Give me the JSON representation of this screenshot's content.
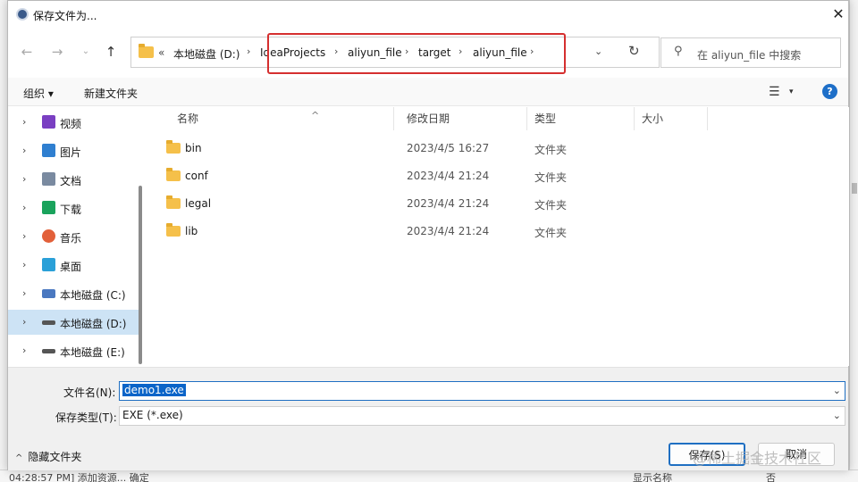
{
  "dialog": {
    "title": "保存文件为...",
    "close_glyph": "✕"
  },
  "nav": {
    "back_glyph": "←",
    "forward_glyph": "→",
    "history_glyph": "⌄",
    "up_glyph": "↑",
    "address_prefix": "«",
    "breadcrumbs": [
      "本地磁盘 (D:)",
      "IdeaProjects",
      "aliyun_file",
      "target",
      "aliyun_file"
    ],
    "separator": "›",
    "dropdown_glyph": "⌄",
    "refresh_glyph": "↻",
    "search_placeholder": "在 aliyun_file 中搜索",
    "search_glyph": "⚲"
  },
  "toolbar": {
    "organize_label": "组织 ▾",
    "new_folder_label": "新建文件夹",
    "view_glyph": "☰",
    "view_dd_glyph": "▾",
    "help_glyph": "?"
  },
  "sidebar": {
    "arrow_glyph": "›",
    "items": [
      {
        "label": "视频",
        "icon": "video-icon",
        "color": "#7a3fc2"
      },
      {
        "label": "图片",
        "icon": "pictures-icon",
        "color": "#2f7fd0"
      },
      {
        "label": "文档",
        "icon": "documents-icon",
        "color": "#7a8aa0"
      },
      {
        "label": "下载",
        "icon": "download-icon",
        "color": "#1aa35c"
      },
      {
        "label": "音乐",
        "icon": "music-icon",
        "color": "#e2603a"
      },
      {
        "label": "桌面",
        "icon": "desktop-icon",
        "color": "#2aa0d8"
      },
      {
        "label": "本地磁盘 (C:)",
        "icon": "drive-c-icon",
        "color": "#4a78c0"
      },
      {
        "label": "本地磁盘 (D:)",
        "icon": "drive-d-icon",
        "color": "#555555"
      },
      {
        "label": "本地磁盘 (E:)",
        "icon": "drive-e-icon",
        "color": "#555555"
      }
    ],
    "selected_index": 7
  },
  "files": {
    "columns": [
      "名称",
      "修改日期",
      "类型",
      "大小"
    ],
    "sort_glyph": "^",
    "rows": [
      {
        "name": "bin",
        "date": "2023/4/5 16:27",
        "type": "文件夹"
      },
      {
        "name": "conf",
        "date": "2023/4/4 21:24",
        "type": "文件夹"
      },
      {
        "name": "legal",
        "date": "2023/4/4 21:24",
        "type": "文件夹"
      },
      {
        "name": "lib",
        "date": "2023/4/4 21:24",
        "type": "文件夹"
      }
    ]
  },
  "form": {
    "filename_label": "文件名(N):",
    "filename_value": "demo1.exe",
    "filetype_label": "保存类型(T):",
    "filetype_value": "EXE (*.exe)",
    "dropdown_glyph": "⌄",
    "hide_folders_label": "隐藏文件夹",
    "hide_folders_glyph": "^",
    "save_label": "保存(S)",
    "cancel_label": "取消"
  },
  "background": {
    "log_text": "04:28:57 PM] 添加资源... 确定",
    "right_text_1": "显示名称",
    "right_text_2": "否"
  },
  "watermark": "@稀土掘金技术社区",
  "colors": {
    "accent": "#1f6fc2",
    "highlight_box": "#d52f2f",
    "selection": "#cde3f5",
    "folder": "#f5c04a"
  }
}
